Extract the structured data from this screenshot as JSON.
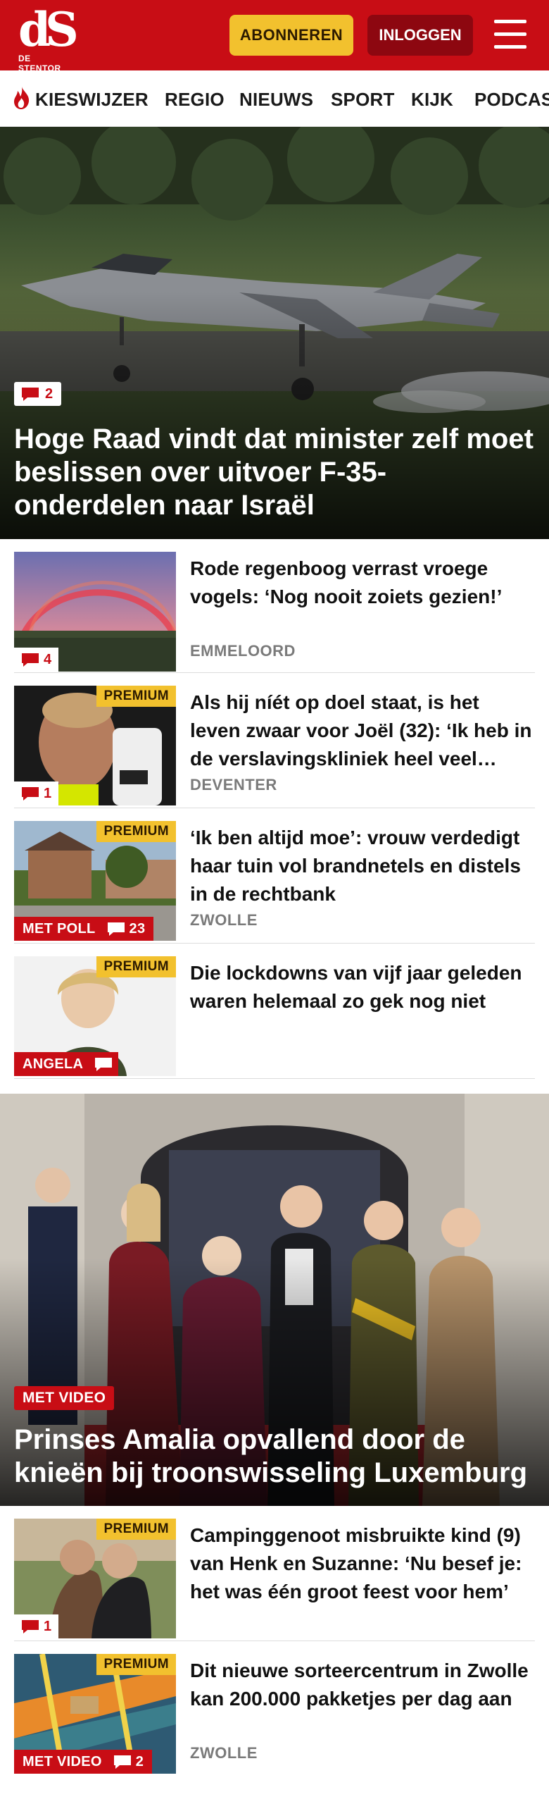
{
  "header": {
    "logo_mark": "dS",
    "logo_sub": "DE STENTOR",
    "subscribe_label": "ABONNEREN",
    "login_label": "INLOGGEN",
    "menu_icon": "hamburger-icon",
    "brand_color": "#c80d15",
    "accent_color": "#f2c12e"
  },
  "nav": {
    "items": [
      {
        "label": "KIESWIJZER",
        "icon": "flame-icon"
      },
      {
        "label": "REGIO"
      },
      {
        "label": "NIEUWS"
      },
      {
        "label": "SPORT"
      },
      {
        "label": "KIJK"
      },
      {
        "label": "PODCAST"
      }
    ]
  },
  "hero1": {
    "comments": "2",
    "title": "Hoge Raad vindt dat minister zelf moet beslissen over uitvoer F-35-onderdelen naar Israël"
  },
  "articles": [
    {
      "title": "Rode regenboog verrast vroege vogels: ‘Nog nooit zoiets gezien!’",
      "location": "EMMELOORD",
      "comments": "4",
      "premium": "",
      "tag": ""
    },
    {
      "title": "Als hij níét op doel staat, is het leven zwaar voor Joël (32): ‘Ik heb in de verslavingskliniek heel veel geleerd’",
      "location": "DEVENTER",
      "comments": "1",
      "premium": "PREMIUM",
      "tag": ""
    },
    {
      "title": "‘Ik ben altijd moe’: vrouw verdedigt haar tuin vol brandne­tels en distels in de rechtbank",
      "location": "ZWOLLE",
      "comments": "23",
      "premium": "PREMIUM",
      "tag": "MET POLL"
    },
    {
      "title": "Die lockdowns van vijf jaar geleden waren helemaal zo gek nog niet",
      "location": "",
      "comments": "",
      "premium": "PREMIUM",
      "tag": "ANGELA"
    }
  ],
  "hero2": {
    "tag": "MET VIDEO",
    "title": "Prinses Amalia opvallend door de knieën bij troonswisseling Luxemburg"
  },
  "articles2": [
    {
      "title": "Campinggenoot misbruikte kind (9) van Henk en Suzanne: ‘Nu besef je: het was één groot feest voor hem’",
      "location": "",
      "comments": "1",
      "premium": "PREMIUM",
      "tag": ""
    },
    {
      "title": "Dit nieuwe sorteercentrum in Zwolle kan 200.000 pakketjes per dag aan",
      "location": "ZWOLLE",
      "comments": "2",
      "premium": "PREMIUM",
      "tag": "MET VIDEO"
    }
  ]
}
